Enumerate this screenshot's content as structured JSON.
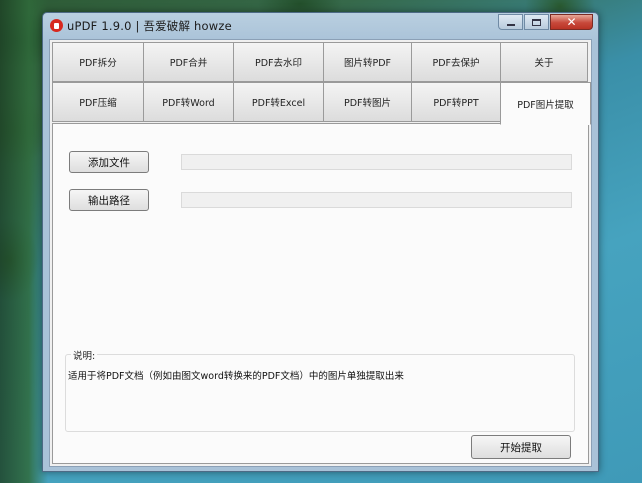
{
  "window": {
    "title": "uPDF 1.9.0 | 吾爱破解 howze",
    "icon": "pdf-app-icon",
    "controls": [
      "minimize",
      "maximize",
      "close"
    ],
    "close_glyph": "✕"
  },
  "tabs_row1": [
    "PDF拆分",
    "PDF合并",
    "PDF去水印",
    "图片转PDF",
    "PDF去保护",
    "关于"
  ],
  "tabs_row2": [
    "PDF压缩",
    "PDF转Word",
    "PDF转Excel",
    "PDF转图片",
    "PDF转PPT",
    "PDF图片提取"
  ],
  "active_tab": "PDF图片提取",
  "panel": {
    "add_file_button": "添加文件",
    "file_path_value": "",
    "output_path_button": "输出路径",
    "output_path_value": "",
    "description_label": "说明:",
    "description_text": "适用于将PDF文档（例如由图文word转换来的PDF文档）中的图片单独提取出来",
    "start_button": "开始提取"
  },
  "colors": {
    "close_button": "#c8493b",
    "app_icon": "#d7281e",
    "panel_bg": "#fbfbfb"
  }
}
